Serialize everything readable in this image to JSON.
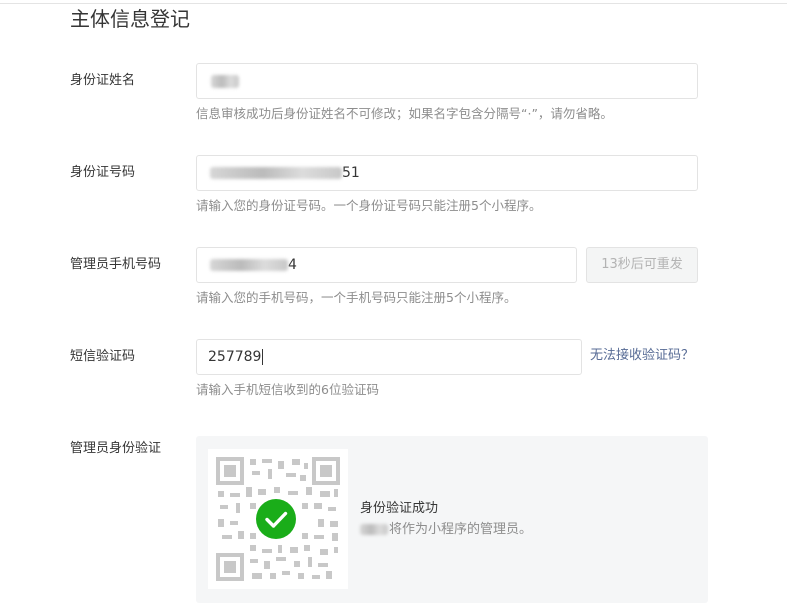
{
  "page": {
    "title": "主体信息登记"
  },
  "form": {
    "name": {
      "label": "身份证姓名",
      "hint": "信息审核成功后身份证姓名不可修改；如果名字包含分隔号“·”，请勿省略。"
    },
    "id_number": {
      "label": "身份证号码",
      "visible_value": "51",
      "hint": "请输入您的身份证号码。一个身份证号码只能注册5个小程序。"
    },
    "phone": {
      "label": "管理员手机号码",
      "visible_value": "4",
      "hint": "请输入您的手机号码，一个手机号码只能注册5个小程序。",
      "resend_label": "13秒后可重发"
    },
    "sms": {
      "label": "短信验证码",
      "value": "257789",
      "link_label": "无法接收验证码？",
      "hint": "请输入手机短信收到的6位验证码"
    },
    "verify": {
      "label": "管理员身份验证",
      "status_title": "身份验证成功",
      "status_desc": "将作为小程序的管理员。"
    }
  },
  "colors": {
    "success": "#1aad19",
    "link": "#576b95",
    "hint": "#8d8d8d"
  }
}
